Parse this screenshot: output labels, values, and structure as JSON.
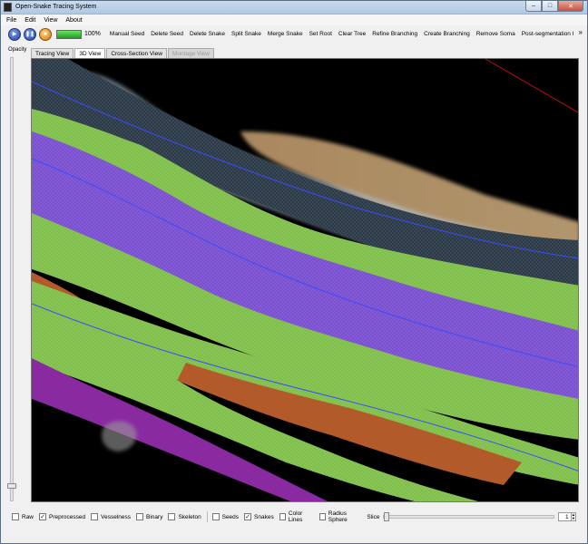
{
  "window": {
    "title": "Open-Snake Tracing System"
  },
  "menu": [
    "File",
    "Edit",
    "View",
    "About"
  ],
  "toolbar": {
    "progress_label": "100%",
    "progress_value": 1.0,
    "buttons": [
      "Manual Seed",
      "Delete Seed",
      "Delete Snake",
      "Split Snake",
      "Merge Snake",
      "Set Root",
      "Clear Tree",
      "Refine Branching",
      "Create Branching",
      "Remove Soma",
      "Post-segmentation I"
    ],
    "extension": "»"
  },
  "side": {
    "opacity_label": "Opacity",
    "opacity_value": 0.03
  },
  "tabs": [
    {
      "label": "Tracing View",
      "state": "normal"
    },
    {
      "label": "3D View",
      "state": "active"
    },
    {
      "label": "Cross-Section View",
      "state": "normal"
    },
    {
      "label": "Montage View",
      "state": "disabled"
    }
  ],
  "bottom": {
    "checkboxes_a": [
      {
        "label": "Raw",
        "checked": false
      },
      {
        "label": "Preprocessed",
        "checked": true
      },
      {
        "label": "Vesselness",
        "checked": false
      },
      {
        "label": "Binary",
        "checked": false
      },
      {
        "label": "Skeleton",
        "checked": false
      }
    ],
    "checkboxes_b": [
      {
        "label": "Seeds",
        "checked": false
      },
      {
        "label": "Snakes",
        "checked": true
      },
      {
        "label": "Color Lines",
        "checked": false
      },
      {
        "label": "Radius Sphere",
        "checked": false
      }
    ],
    "slice_label": "Slice",
    "slice_value": "1",
    "slice_position": 0.0
  },
  "colors": {
    "dark_band": "#2c3a48",
    "purple_band": "#7a4fd0",
    "green_band": "#7fbf4a",
    "orange_band": "#b35a2a",
    "magenta_band": "#8a2aa0",
    "trace_line": "#3a4cff"
  }
}
